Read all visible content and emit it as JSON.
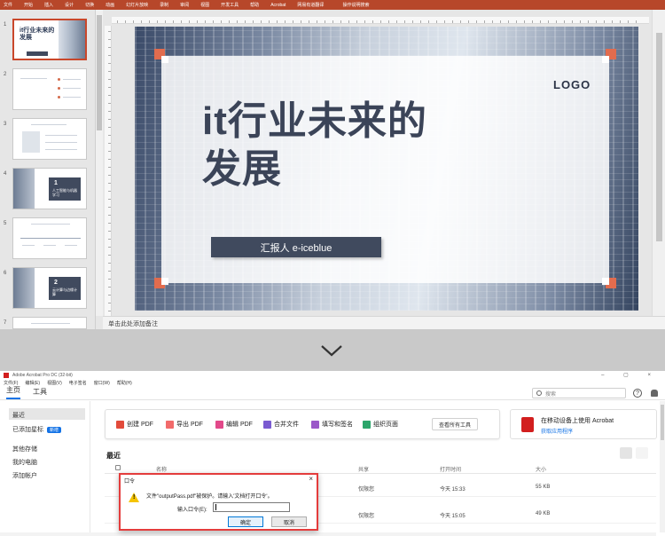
{
  "ppt": {
    "menu": [
      "文件",
      "开始",
      "插入",
      "设计",
      "切换",
      "动画",
      "幻灯片放映",
      "录制",
      "审阅",
      "视图",
      "开发工具",
      "帮助",
      "Acrobat",
      "网易有道翻译"
    ],
    "tell_me": "操作说明搜索",
    "thumb_numbers": [
      "1",
      "2",
      "3",
      "4",
      "5",
      "6",
      "7"
    ],
    "thumbs": {
      "t1": "it行业未来的发展",
      "t4_num": "1",
      "t4_text": "人工智能与机器学习",
      "t6_num": "2",
      "t6_text": "云计算与边缘计算"
    },
    "slide": {
      "title_line1": "it行业未来的",
      "title_line2": "发展",
      "logo": "LOGO",
      "reporter": "汇报人 e-iceblue"
    },
    "notes": "单击此处添加备注",
    "colors": {
      "ribbon": "#b7472a",
      "accent": "#e26c4e",
      "dark": "#404a5e"
    }
  },
  "acrobat": {
    "title": "Adobe Acrobat Pro DC (32-bit)",
    "menu": [
      "文件(F)",
      "编辑(E)",
      "视图(V)",
      "电子签名",
      "窗口(W)",
      "帮助(H)"
    ],
    "tabs": [
      "主页",
      "工具"
    ],
    "search_placeholder": "搜索",
    "help": "?",
    "sidebar": {
      "recent": "最近",
      "starred": "已添加星标",
      "starred_badge": "新增",
      "other_storage": "其他存储",
      "my_computer": "我的电脑",
      "add_account": "添加帐户"
    },
    "tools": {
      "create": "创建 PDF",
      "export": "导出 PDF",
      "edit": "编辑 PDF",
      "combine": "合并文件",
      "fill_sign": "填写和签名",
      "organize": "组织页面",
      "view_all": "查看所有工具"
    },
    "promo": {
      "title": "在移动设备上使用 Acrobat",
      "link": "获取应用程序"
    },
    "recent_heading": "最近",
    "columns": {
      "name": "名称",
      "share": "共享",
      "opened": "打开时间",
      "size": "大小"
    },
    "rows": [
      {
        "share": "仅限您",
        "opened": "今天 15:33",
        "size": "55 KB"
      },
      {
        "share": "仅限您",
        "opened": "今天 15:05",
        "size": "49 KB"
      }
    ],
    "dialog": {
      "title": "口令",
      "close": "×",
      "message": "文件\"outputPass.pdf\"被保护。请输入'文档打开口令'。",
      "label": "输入口令(E):",
      "ok": "确定",
      "cancel": "取消"
    },
    "colors": {
      "brand": "#d21e1e",
      "link": "#1473e6",
      "highlight": "#e43c3c"
    }
  }
}
